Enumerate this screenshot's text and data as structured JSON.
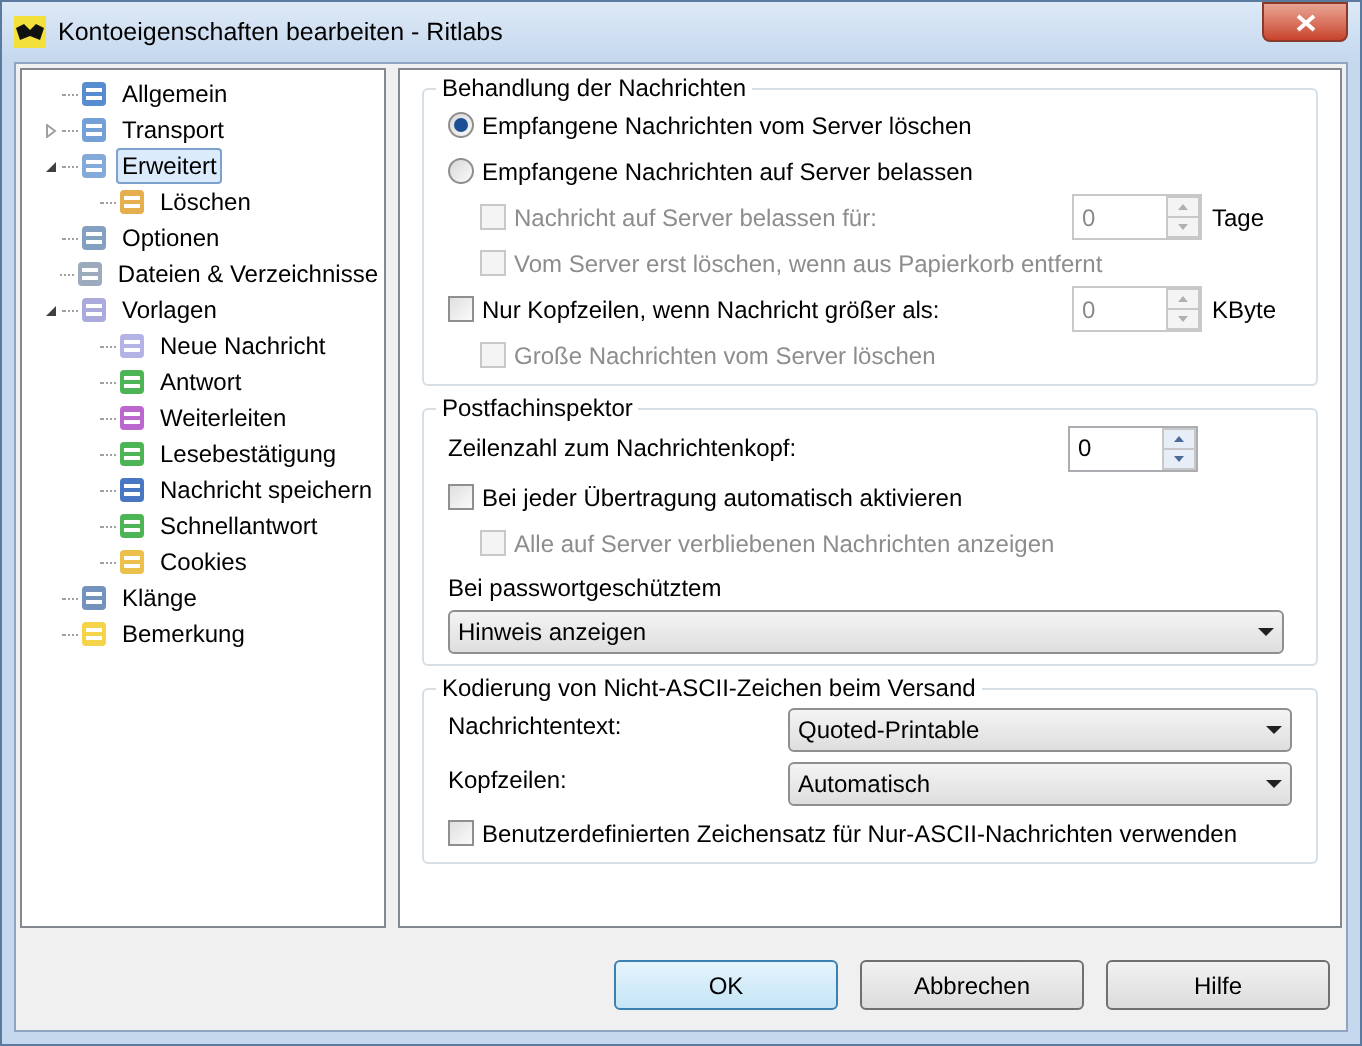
{
  "window": {
    "title": "Kontoeigenschaften bearbeiten - Ritlabs"
  },
  "tree": [
    {
      "label": "Allgemein",
      "selected": false
    },
    {
      "label": "Transport",
      "selected": false,
      "expanded": false
    },
    {
      "label": "Erweitert",
      "selected": true,
      "expanded": true,
      "children": [
        {
          "label": "Löschen",
          "selected": false
        }
      ]
    },
    {
      "label": "Optionen",
      "selected": false
    },
    {
      "label": "Dateien & Verzeichnisse",
      "selected": false
    },
    {
      "label": "Vorlagen",
      "selected": false,
      "expanded": true,
      "children": [
        {
          "label": "Neue Nachricht",
          "selected": false
        },
        {
          "label": "Antwort",
          "selected": false
        },
        {
          "label": "Weiterleiten",
          "selected": false
        },
        {
          "label": "Lesebestätigung",
          "selected": false
        },
        {
          "label": "Nachricht speichern",
          "selected": false
        },
        {
          "label": "Schnellantwort",
          "selected": false
        },
        {
          "label": "Cookies",
          "selected": false
        }
      ]
    },
    {
      "label": "Klänge",
      "selected": false
    },
    {
      "label": "Bemerkung",
      "selected": false
    }
  ],
  "groups": [
    {
      "title": "Behandlung der Nachrichten",
      "rows": [
        {
          "kind": "radio",
          "label": "Empfangene Nachrichten vom Server löschen",
          "selected": true,
          "disabled": false
        },
        {
          "kind": "radio",
          "label": "Empfangene Nachrichten auf Server belassen",
          "selected": false,
          "disabled": false,
          "children": [
            {
              "kind": "checkbox",
              "label": "Nachricht auf Server belassen für:",
              "checked": false,
              "disabled": true,
              "spin": {
                "value": "0",
                "unit": "Tage",
                "disabled": true
              }
            },
            {
              "kind": "checkbox",
              "label": "Vom Server erst löschen, wenn aus Papierkorb entfernt",
              "checked": false,
              "disabled": true
            }
          ]
        },
        {
          "kind": "checkbox",
          "label": "Nur Kopfzeilen, wenn Nachricht größer als:",
          "checked": false,
          "disabled": false,
          "spin": {
            "value": "0",
            "unit": "KByte",
            "disabled": true
          },
          "children": [
            {
              "kind": "checkbox",
              "label": "Große Nachrichten vom Server löschen",
              "checked": false,
              "disabled": true
            }
          ]
        }
      ]
    },
    {
      "title": "Postfachinspektor",
      "rows": [
        {
          "kind": "spin",
          "label": "Zeilenzahl zum Nachrichtenkopf:",
          "spin": {
            "value": "0",
            "disabled": false
          }
        },
        {
          "kind": "checkbox",
          "label": "Bei jeder Übertragung automatisch aktivieren",
          "checked": false,
          "disabled": false,
          "children": [
            {
              "kind": "checkbox",
              "label": "Alle auf Server verbliebenen Nachrichten anzeigen",
              "checked": false,
              "disabled": true
            }
          ]
        },
        {
          "kind": "label",
          "label": "Bei passwortgeschütztem"
        },
        {
          "kind": "select",
          "value": "Hinweis anzeigen"
        }
      ]
    },
    {
      "title": "Kodierung von Nicht-ASCII-Zeichen beim Versand",
      "rows": [
        {
          "kind": "labeled_select",
          "label": "Nachrichtentext:",
          "value": "Quoted-Printable"
        },
        {
          "kind": "labeled_select",
          "label": "Kopfzeilen:",
          "value": "Automatisch"
        },
        {
          "kind": "checkbox",
          "label": "Benutzerdefinierten Zeichensatz für Nur-ASCII-Nachrichten verwenden",
          "checked": false,
          "disabled": false
        }
      ]
    }
  ],
  "buttons": [
    {
      "label": "OK",
      "default": true
    },
    {
      "label": "Abbrechen",
      "default": false
    },
    {
      "label": "Hilfe",
      "default": false
    }
  ]
}
